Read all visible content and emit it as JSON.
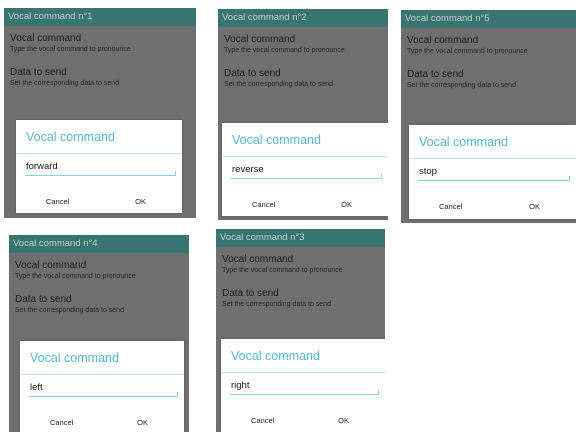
{
  "screens": [
    {
      "title": "Vocal command n°1",
      "settings": [
        {
          "title": "Vocal command",
          "summary": "Type the vocal command to pronounce"
        },
        {
          "title": "Data to send",
          "summary": "Set the corresponding data to send"
        }
      ],
      "dialog": {
        "title": "Vocal command",
        "value": "forward",
        "cancel_label": "Cancel",
        "ok_label": "OK"
      }
    },
    {
      "title": "Vocal command n°2",
      "settings": [
        {
          "title": "Vocal command",
          "summary": "Type the vocal command to pronounce"
        },
        {
          "title": "Data to send",
          "summary": "Set the corresponding data to send"
        }
      ],
      "dialog": {
        "title": "Vocal command",
        "value": "reverse",
        "cancel_label": "Cancel",
        "ok_label": "OK"
      }
    },
    {
      "title": "Vocal command n°5",
      "settings": [
        {
          "title": "Vocal command",
          "summary": "Type the vocal command to pronounce"
        },
        {
          "title": "Data to send",
          "summary": "Set the corresponding data to send"
        }
      ],
      "dialog": {
        "title": "Vocal command",
        "value": "stop",
        "cancel_label": "Cancel",
        "ok_label": "OK"
      }
    },
    {
      "title": "Vocal command n°4",
      "settings": [
        {
          "title": "Vocal command",
          "summary": "Type the vocal command to pronounce"
        },
        {
          "title": "Data to send",
          "summary": "Set the corresponding data to send"
        }
      ],
      "dialog": {
        "title": "Vocal command",
        "value": "left",
        "cancel_label": "Cancel",
        "ok_label": "OK"
      }
    },
    {
      "title": "Vocal command n°3",
      "settings": [
        {
          "title": "Vocal command",
          "summary": "Type the vocal command to pronounce"
        },
        {
          "title": "Data to send",
          "summary": "Set the corresponding data to send"
        }
      ],
      "dialog": {
        "title": "Vocal command",
        "value": "right",
        "cancel_label": "Cancel",
        "ok_label": "OK"
      }
    }
  ],
  "colors": {
    "titlebar": "#3a7470",
    "screen_dimmed": "#6f6f6f",
    "dialog_title": "#53b8ce",
    "input_underline": "#7fd3e6"
  }
}
